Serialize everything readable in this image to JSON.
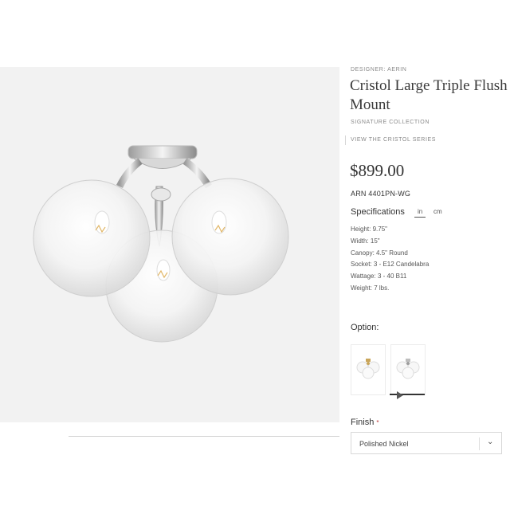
{
  "product": {
    "designer": "DESIGNER: AERIN",
    "title": "Cristol Large Triple Flush Mount",
    "collection": "SIGNATURE COLLECTION",
    "series_link": "VIEW THE CRISTOL SERIES",
    "price": "$899.00",
    "sku": "ARN 4401PN-WG"
  },
  "specifications": {
    "heading": "Specifications",
    "units": [
      "in",
      "cm"
    ],
    "selected_unit": "in",
    "items": [
      "Height: 9.75\"",
      "Width: 15\"",
      "Canopy: 4.5\" Round",
      "Socket: 3 - E12 Candelabra",
      "Wattage: 3 - 40 B11",
      "Weight: 7 lbs."
    ]
  },
  "option": {
    "label": "Option:",
    "selected_index": 1,
    "swatches": [
      "brass-globe-thumbnail",
      "nickel-globe-thumbnail"
    ]
  },
  "finish": {
    "label": "Finish",
    "required_mark": "*",
    "selected": "Polished Nickel"
  },
  "colors": {
    "hero_background": "#f2f2f2",
    "text_dark": "#333333",
    "text_muted": "#888888"
  }
}
